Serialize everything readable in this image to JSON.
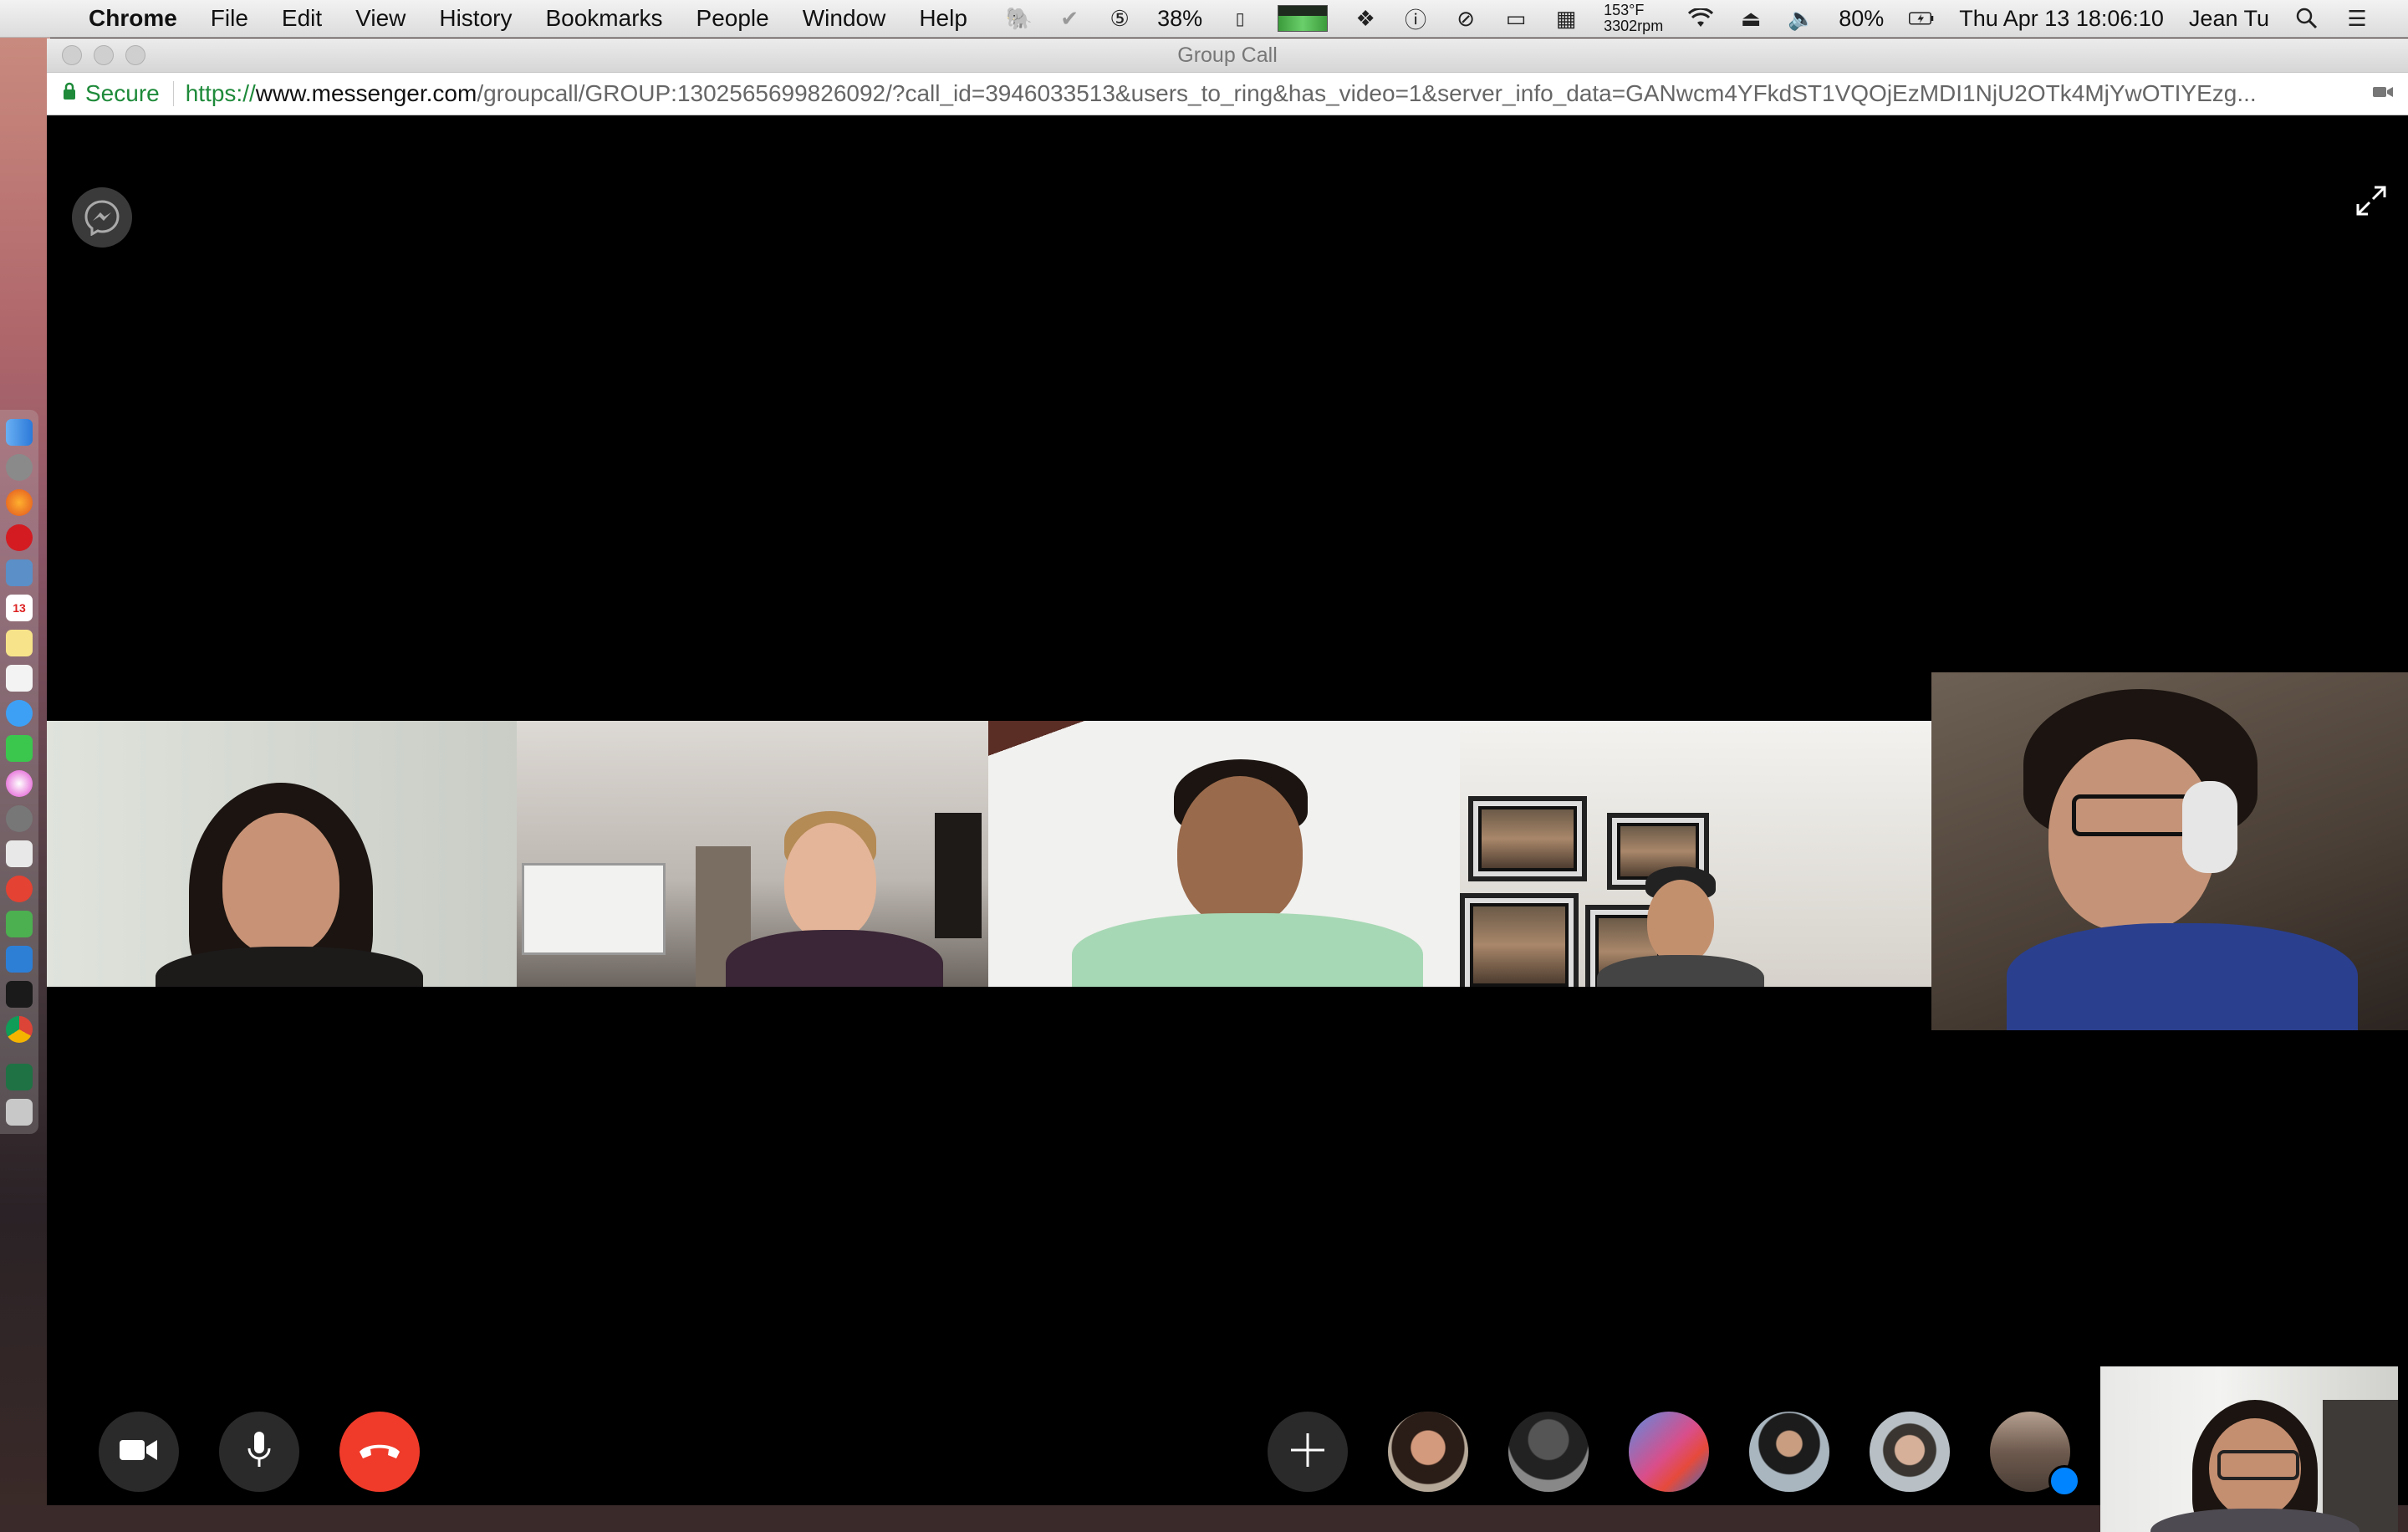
{
  "menubar": {
    "app_name": "Chrome",
    "menus": [
      "File",
      "Edit",
      "View",
      "History",
      "Bookmarks",
      "People",
      "Window",
      "Help"
    ],
    "cpu_percent": "38%",
    "temp": "153°F",
    "fan": "3302rpm",
    "battery": "80%",
    "datetime": "Thu Apr 13  18:06:10",
    "user": "Jean Tu"
  },
  "window": {
    "title": "Group Call",
    "secure_label": "Secure",
    "url_scheme": "https://",
    "url_host": "www.messenger.com",
    "url_path": "/groupcall/GROUP:1302565699826092/?call_id=3946033513&users_to_ring&has_video=1&server_info_data=GANwcm4YFkdST1VQOjEzMDI1NjU2OTk4MjYwOTIYEzg..."
  },
  "call": {
    "participants_on_stage": 5,
    "ringing_avatars": 6,
    "controls": [
      "video-camera",
      "microphone",
      "end-call",
      "add-participant"
    ]
  },
  "colors": {
    "end_call": "#f03b2a",
    "secure_green": "#1e8a3a",
    "messenger_badge": "#0084ff"
  },
  "icons": [
    "apple-icon",
    "messenger-logo-icon",
    "expand-icon",
    "video-camera-icon",
    "microphone-icon",
    "phone-hangup-icon",
    "plus-icon",
    "lock-icon",
    "camera-blocked-icon",
    "wifi-icon",
    "volume-icon",
    "search-icon",
    "list-icon"
  ]
}
